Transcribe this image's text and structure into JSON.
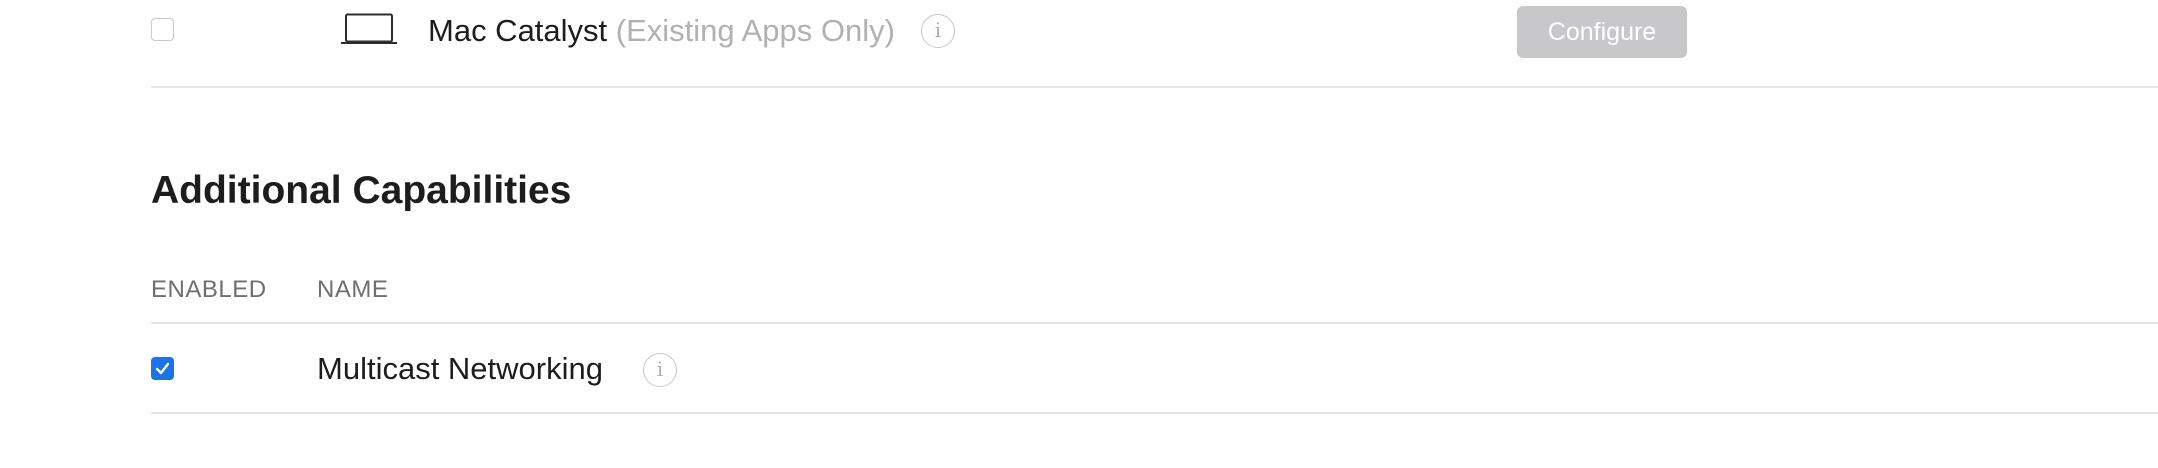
{
  "platform_row": {
    "name": "Mac Catalyst",
    "note": "(Existing Apps Only)",
    "checked": false,
    "icon": "laptop-icon",
    "info_icon": "info-icon",
    "info_glyph": "i",
    "configure_label": "Configure"
  },
  "additional_capabilities": {
    "title": "Additional Capabilities",
    "columns": {
      "enabled": "ENABLED",
      "name": "NAME"
    },
    "rows": [
      {
        "name": "Multicast Networking",
        "enabled": true,
        "info_icon": "info-icon",
        "info_glyph": "i"
      }
    ]
  },
  "colors": {
    "checkbox_checked": "#1a73e8",
    "button_disabled": "#c8c8cb",
    "muted_text": "#b0b0b5"
  }
}
